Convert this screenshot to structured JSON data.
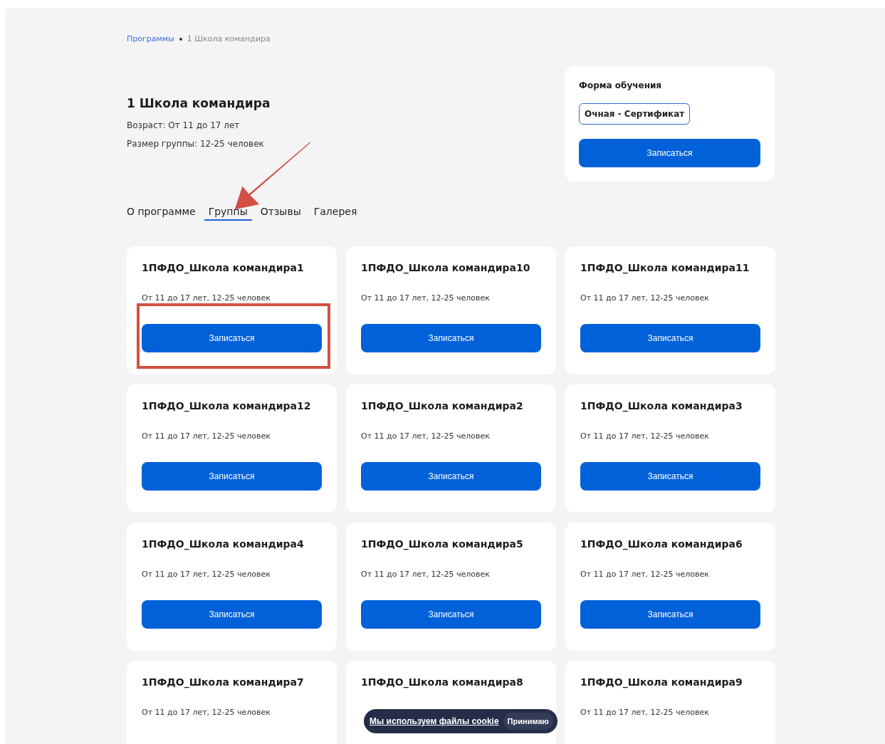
{
  "breadcrumbs": [
    {
      "label": "Программы",
      "link": true
    },
    {
      "label": "1 Школа командира",
      "link": false
    }
  ],
  "program": {
    "title": "1 Школа командира",
    "facts": [
      "Возраст: От 11 до 17 лет",
      "Размер группы: 12-25 человек"
    ]
  },
  "enroll_panel": {
    "label": "Форма обучения",
    "options": [
      {
        "label": "Очная - Сертификат",
        "selected": true
      }
    ],
    "button": "Записаться"
  },
  "tabs": [
    {
      "label": "О программе",
      "selected": false
    },
    {
      "label": "Группы",
      "selected": true
    },
    {
      "label": "Отзывы",
      "selected": false
    },
    {
      "label": "Галерея",
      "selected": false
    }
  ],
  "groups": [
    {
      "title": "1ПФДО_Школа командира1",
      "meta": "От 11 до 17 лет, 12-25 человек",
      "button": "Записаться",
      "highlighted": true
    },
    {
      "title": "1ПФДО_Школа командира10",
      "meta": "От 11 до 17 лет, 12-25 человек",
      "button": "Записаться",
      "highlighted": false
    },
    {
      "title": "1ПФДО_Школа командира11",
      "meta": "От 11 до 17 лет, 12-25 человек",
      "button": "Записаться",
      "highlighted": false
    },
    {
      "title": "1ПФДО_Школа командира12",
      "meta": "От 11 до 17 лет, 12-25 человек",
      "button": "Записаться",
      "highlighted": false
    },
    {
      "title": "1ПФДО_Школа командира2",
      "meta": "От 11 до 17 лет, 12-25 человек",
      "button": "Записаться",
      "highlighted": false
    },
    {
      "title": "1ПФДО_Школа командира3",
      "meta": "От 11 до 17 лет, 12-25 человек",
      "button": "Записаться",
      "highlighted": false
    },
    {
      "title": "1ПФДО_Школа командира4",
      "meta": "От 11 до 17 лет, 12-25 человек",
      "button": "Записаться",
      "highlighted": false
    },
    {
      "title": "1ПФДО_Школа командира5",
      "meta": "От 11 до 17 лет, 12-25 человек",
      "button": "Записаться",
      "highlighted": false
    },
    {
      "title": "1ПФДО_Школа командира6",
      "meta": "От 11 до 17 лет, 12-25 человек",
      "button": "Записаться",
      "highlighted": false
    },
    {
      "title": "1ПФДО_Школа командира7",
      "meta": "От 11 до 17 лет, 12-25 человек",
      "highlighted": false
    },
    {
      "title": "1ПФДО_Школа командира8",
      "highlighted": false
    },
    {
      "title": "1ПФДО_Школа командира9",
      "meta": "От 11 до 17 лет, 12-25 человек",
      "highlighted": false
    }
  ],
  "cookie_banner": {
    "text": "Мы используем файлы cookie",
    "button": "Принимаю"
  }
}
